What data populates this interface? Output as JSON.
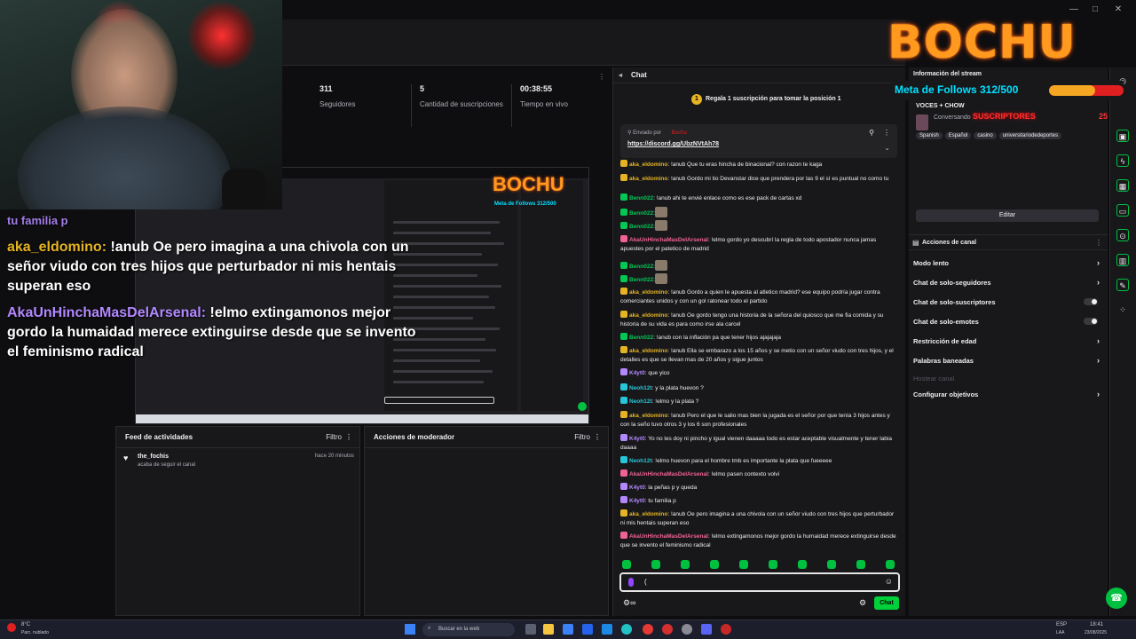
{
  "window": {
    "min": "—",
    "max": "□",
    "close": "✕"
  },
  "stats": [
    {
      "value": "311",
      "label": "Seguidores"
    },
    {
      "value": "5",
      "label": "Cantidad de suscripciones"
    },
    {
      "value": "00:38:55",
      "label": "Tiempo en vivo"
    }
  ],
  "overlay_chat": [
    {
      "user": "aka_eldomino:",
      "text": " !anub Oe pero imagina a una chivola con un señor viudo con tres hijos que perturbador ni mis hentais superan eso"
    },
    {
      "user": "AkaUnHinchaMasDelArsenal:",
      "text": " !elmo extingamonos mejor gordo la humaidad merece extinguirse desde que se invento el feminismo radical"
    }
  ],
  "overlay_top_fragment": "tu familia p",
  "preview_logo": "BOCHU",
  "preview_meta": "Meta de Follows 312/500",
  "activity_feed": {
    "title": "Feed de actividades",
    "filter": "Filtro",
    "items": [
      {
        "user": "the_fochis",
        "action": "acaba de seguir el canal",
        "time": "hace 20 minutos"
      }
    ]
  },
  "mod_actions": {
    "title": "Acciones de moderador",
    "filter": "Filtro"
  },
  "chat": {
    "title": "Chat",
    "gift_banner": "Regala 1 suscripción para tomar la posición 1",
    "pinned_label": "Enviado por",
    "pinned_user": "Bochu",
    "pinned_link": "https://discord.gg/UbzNVtAh78",
    "messages": [
      {
        "user": "aka_eldomino",
        "color": "#e6b422",
        "text": ": !anub Que tu eras hincha de binacional? con razon te kaga"
      },
      {
        "user": "aka_eldomino",
        "color": "#e6b422",
        "text": ": !anub Gordo mi tio Devanstar dice que prendera por las 9 el sí es puntual no como tu"
      },
      {
        "user": "Benn022",
        "color": "#00c853",
        "text": ": !anub ahi te envié enlace como es ese pack de cartas xd"
      },
      {
        "user": "Benn022",
        "color": "#00c853",
        "text": ":"
      },
      {
        "user": "Benn022",
        "color": "#00c853",
        "text": ":"
      },
      {
        "user": "AkaUnHinchaMasDelArsenal",
        "color": "#f06292",
        "text": ": !elmo gordo yo descubrí la regla de todo apostador nunca jamas apuestes por el patetico de madrid"
      },
      {
        "user": "Benn022",
        "color": "#00c853",
        "text": ":"
      },
      {
        "user": "Benn022",
        "color": "#00c853",
        "text": ":"
      },
      {
        "user": "aka_eldomino",
        "color": "#e6b422",
        "text": ": !anub Gordo a quien le apuesta al atletico madrid? ese equipo podría jugar contra comerciantes unidos y con un gol ratonear todo el partido"
      },
      {
        "user": "aka_eldomino",
        "color": "#e6b422",
        "text": ": !anub Oe gordo tengo una historia de la señora del quiosco que me fia comida y su historia de su vida es para como irse ala carcel"
      },
      {
        "user": "Benn022",
        "color": "#00c853",
        "text": ": !anub con la inflación pa que tener hijos ajajajaja"
      },
      {
        "user": "aka_eldomino",
        "color": "#e6b422",
        "text": ": !anub Ella se embarazo a los 15 años y se metio con un señor viudo con tres hijos, y el detalles es que se llevan mas de 20 años y sigue juntos"
      },
      {
        "user": "K4yt0",
        "color": "#b388ff",
        "text": ": que yico"
      },
      {
        "user": "Neoh12t",
        "color": "#26c6da",
        "text": ": y la plata huevon ?"
      },
      {
        "user": "Neoh12t",
        "color": "#26c6da",
        "text": ": !elmo y la plata ?"
      },
      {
        "user": "aka_eldomino",
        "color": "#e6b422",
        "text": ": !anub Pero el que le salio mas bien la jugada es el señor por que tenía 3 hijos antes y con la seño tuvo otros 3 y los 6 son profesionales"
      },
      {
        "user": "K4yt0",
        "color": "#b388ff",
        "text": ": Yo no les doy ni pincho y igual vienen daaaaa todo es estar aceptable visualmente y tener labia daaaa"
      },
      {
        "user": "Neoh12t",
        "color": "#26c6da",
        "text": ": !elmo huevon para el hombre tmb es importante la plata que fueeeee"
      },
      {
        "user": "AkaUnHinchaMasDelArsenal",
        "color": "#f06292",
        "text": ": !elmo pasen contexto volvi"
      },
      {
        "user": "K4yt0",
        "color": "#b388ff",
        "text": ": la peñas p y queda"
      },
      {
        "user": "K4yt0",
        "color": "#b388ff",
        "text": ": tu familia p"
      },
      {
        "user": "aka_eldomino",
        "color": "#e6b422",
        "text": ": !anub Oe pero imagina a una chivola con un señor viudo con tres hijos que perturbador ni mis hentais superan eso"
      },
      {
        "user": "AkaUnHinchaMasDelArsenal",
        "color": "#f06292",
        "text": ": !elmo extingamonos mejor gordo la humaidad merece extinguirse desde que se invento el feminismo radical"
      }
    ],
    "input_value": "(",
    "send_label": "Chat"
  },
  "stream_info": {
    "title": "Información del stream",
    "stream_title": "VOCES + CHOW",
    "category_prefix": "Conversando",
    "tags": [
      "Spanish",
      "Español",
      "casino",
      "universitariodedeportes"
    ],
    "edit_label": "Editar"
  },
  "channel_actions": {
    "title": "Acciones de canal",
    "items": [
      {
        "label": "Modo lento",
        "kind": "chevron"
      },
      {
        "label": "Chat de solo-seguidores",
        "kind": "chevron"
      },
      {
        "label": "Chat de solo-suscriptores",
        "kind": "toggle"
      },
      {
        "label": "Chat de solo-emotes",
        "kind": "toggle"
      },
      {
        "label": "Restricción de edad",
        "kind": "chevron"
      },
      {
        "label": "Palabras baneadas",
        "kind": "chevron"
      },
      {
        "label": "Hostear canal",
        "kind": "disabled"
      },
      {
        "label": "Configurar objetivos",
        "kind": "chevron"
      }
    ]
  },
  "overlay": {
    "logo": "BOCHU",
    "follows_label": "Meta de Follows 312/500",
    "follows_current": 312,
    "follows_goal": 500,
    "subs_label": "SUSCRIPTORES",
    "subs_count": "25"
  },
  "taskbar": {
    "weather_temp": "8°C",
    "weather_desc": "Parc. nublado",
    "search_placeholder": "Buscar en la web",
    "lang": "ESP",
    "lang2": "LAA",
    "time": "18:41",
    "date": "23/08/2025"
  }
}
